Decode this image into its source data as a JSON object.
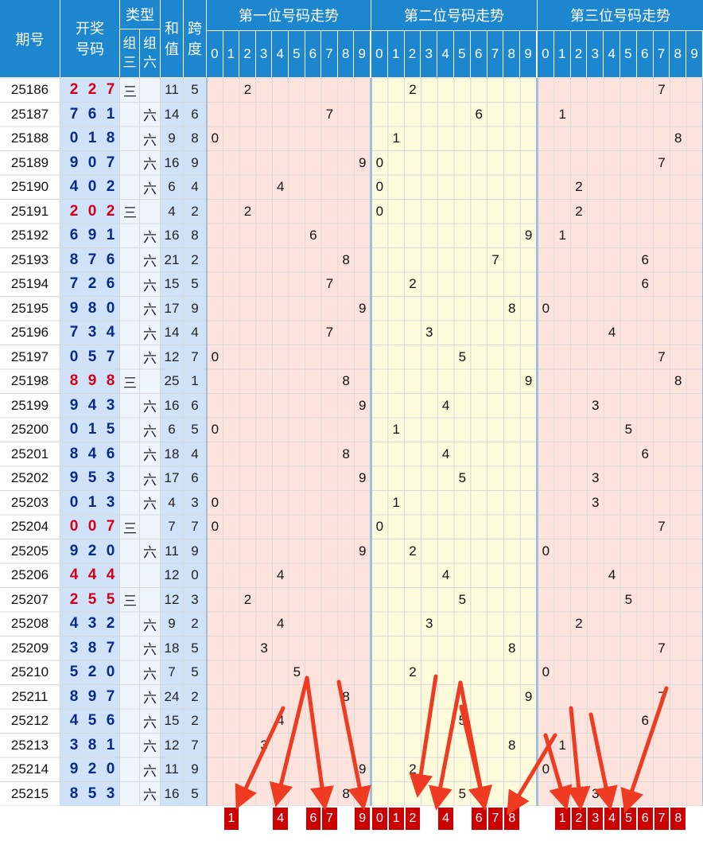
{
  "header": {
    "issue": "期号",
    "draw": "开奖\n号码",
    "type": "类型",
    "type_g3": "组\n三",
    "type_g6": "组\n六",
    "sum": "和\n值",
    "span": "跨\n度",
    "pos1": "第一位号码走势",
    "pos2": "第二位号码走势",
    "pos3": "第三位号码走势"
  },
  "digits_header": [
    "0",
    "1",
    "2",
    "3",
    "4",
    "5",
    "6",
    "7",
    "8",
    "9"
  ],
  "colors": {
    "header_blue": "#1c86ce",
    "zone_pink": "#fde3dc",
    "zone_yellow": "#fefbdc",
    "draw_bg": "#cfe2f8",
    "digit_blue": "#0a2a8a",
    "digit_red": "#d4001a",
    "prediction_red": "#cc0000",
    "arrow_red": "#ee3b22",
    "grid": "#d9d9d9"
  },
  "chart_data": {
    "type": "table",
    "rows": [
      {
        "issue": "25186",
        "n": [
          2,
          2,
          7
        ],
        "t": "三",
        "sum": "11",
        "span": "5"
      },
      {
        "issue": "25187",
        "n": [
          7,
          6,
          1
        ],
        "t": "六",
        "sum": "14",
        "span": "6"
      },
      {
        "issue": "25188",
        "n": [
          0,
          1,
          8
        ],
        "t": "六",
        "sum": "9",
        "span": "8"
      },
      {
        "issue": "25189",
        "n": [
          9,
          0,
          7
        ],
        "t": "六",
        "sum": "16",
        "span": "9"
      },
      {
        "issue": "25190",
        "n": [
          4,
          0,
          2
        ],
        "t": "六",
        "sum": "6",
        "span": "4"
      },
      {
        "issue": "25191",
        "n": [
          2,
          0,
          2
        ],
        "t": "三",
        "sum": "4",
        "span": "2"
      },
      {
        "issue": "25192",
        "n": [
          6,
          9,
          1
        ],
        "t": "六",
        "sum": "16",
        "span": "8"
      },
      {
        "issue": "25193",
        "n": [
          8,
          7,
          6
        ],
        "t": "六",
        "sum": "21",
        "span": "2"
      },
      {
        "issue": "25194",
        "n": [
          7,
          2,
          6
        ],
        "t": "六",
        "sum": "15",
        "span": "5"
      },
      {
        "issue": "25195",
        "n": [
          9,
          8,
          0
        ],
        "t": "六",
        "sum": "17",
        "span": "9"
      },
      {
        "issue": "25196",
        "n": [
          7,
          3,
          4
        ],
        "t": "六",
        "sum": "14",
        "span": "4"
      },
      {
        "issue": "25197",
        "n": [
          0,
          5,
          7
        ],
        "t": "六",
        "sum": "12",
        "span": "7"
      },
      {
        "issue": "25198",
        "n": [
          8,
          9,
          8
        ],
        "t": "三",
        "sum": "25",
        "span": "1"
      },
      {
        "issue": "25199",
        "n": [
          9,
          4,
          3
        ],
        "t": "六",
        "sum": "16",
        "span": "6"
      },
      {
        "issue": "25200",
        "n": [
          0,
          1,
          5
        ],
        "t": "六",
        "sum": "6",
        "span": "5"
      },
      {
        "issue": "25201",
        "n": [
          8,
          4,
          6
        ],
        "t": "六",
        "sum": "18",
        "span": "4"
      },
      {
        "issue": "25202",
        "n": [
          9,
          5,
          3
        ],
        "t": "六",
        "sum": "17",
        "span": "6"
      },
      {
        "issue": "25203",
        "n": [
          0,
          1,
          3
        ],
        "t": "六",
        "sum": "4",
        "span": "3"
      },
      {
        "issue": "25204",
        "n": [
          0,
          0,
          7
        ],
        "t": "三",
        "sum": "7",
        "span": "7"
      },
      {
        "issue": "25205",
        "n": [
          9,
          2,
          0
        ],
        "t": "六",
        "sum": "11",
        "span": "9"
      },
      {
        "issue": "25206",
        "n": [
          4,
          4,
          4
        ],
        "t": "",
        "sum": "12",
        "span": "0"
      },
      {
        "issue": "25207",
        "n": [
          2,
          5,
          5
        ],
        "t": "三",
        "sum": "12",
        "span": "3"
      },
      {
        "issue": "25208",
        "n": [
          4,
          3,
          2
        ],
        "t": "六",
        "sum": "9",
        "span": "2"
      },
      {
        "issue": "25209",
        "n": [
          3,
          8,
          7
        ],
        "t": "六",
        "sum": "18",
        "span": "5"
      },
      {
        "issue": "25210",
        "n": [
          5,
          2,
          0
        ],
        "t": "六",
        "sum": "7",
        "span": "5"
      },
      {
        "issue": "25211",
        "n": [
          8,
          9,
          7
        ],
        "t": "六",
        "sum": "24",
        "span": "2"
      },
      {
        "issue": "25212",
        "n": [
          4,
          5,
          6
        ],
        "t": "六",
        "sum": "15",
        "span": "2"
      },
      {
        "issue": "25213",
        "n": [
          3,
          8,
          1
        ],
        "t": "六",
        "sum": "12",
        "span": "7"
      },
      {
        "issue": "25214",
        "n": [
          9,
          2,
          0
        ],
        "t": "六",
        "sum": "11",
        "span": "9"
      },
      {
        "issue": "25215",
        "n": [
          8,
          5,
          3
        ],
        "t": "六",
        "sum": "16",
        "span": "5"
      }
    ],
    "prediction": {
      "pos1": [
        1,
        4,
        6,
        7,
        9
      ],
      "pos2": [
        0,
        1,
        2,
        4,
        6,
        7,
        8
      ],
      "pos3": [
        1,
        2,
        3,
        4,
        5,
        6,
        7,
        8
      ]
    }
  }
}
